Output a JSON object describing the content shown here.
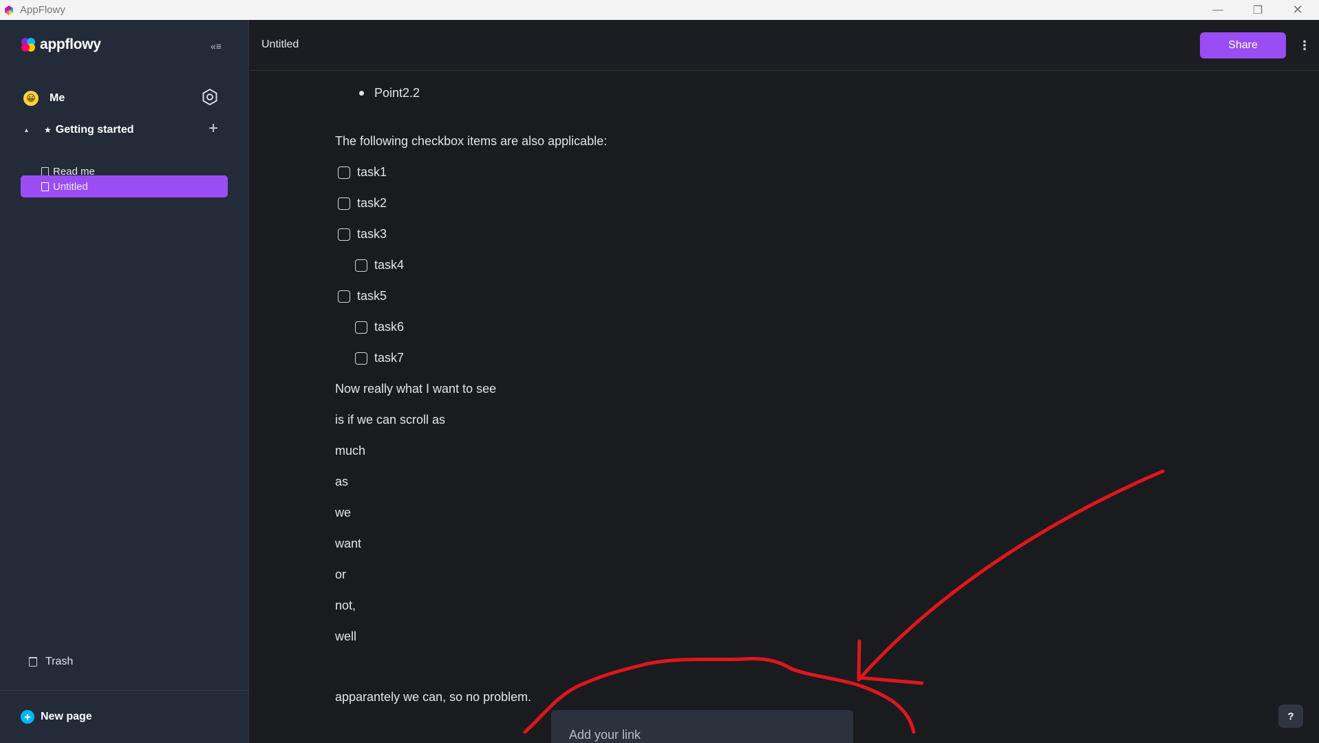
{
  "window": {
    "title": "AppFlowy",
    "controls": {
      "minimize": "—",
      "maximize": "❐",
      "close": "✕"
    }
  },
  "sidebar": {
    "brand": "appflowy",
    "collapse_icon": "«≡",
    "user": {
      "avatar": "😀",
      "name": "Me"
    },
    "section": {
      "label": "Getting started",
      "star": "★",
      "add": "+"
    },
    "pages": [
      {
        "label": "Read me"
      },
      {
        "label": "Untitled"
      }
    ],
    "trash_label": "Trash",
    "new_page": {
      "icon": "+",
      "label": "New page"
    }
  },
  "header": {
    "title": "Untitled",
    "share_label": "Share",
    "more_icon": "⋮"
  },
  "document": {
    "bullet_item": "Point2.2",
    "checkbox_intro": "The following checkbox items are also applicable:",
    "checkboxes": [
      "task1",
      "task2",
      "task3",
      "task4",
      "task5",
      "task6",
      "task7"
    ],
    "lines": [
      "Now really what I want to see",
      "is if we can scroll as",
      "much",
      "as",
      "we",
      "want",
      "or",
      "not,",
      "well"
    ],
    "final_line": "apparantely we can, so no problem."
  },
  "link_popup": {
    "placeholder": "Add your link"
  },
  "help_label": "?",
  "colors": {
    "accent": "#9a4df2",
    "sidebar_bg": "#232b38",
    "editor_bg": "#1a1b1f",
    "annotation": "#e0161b"
  }
}
